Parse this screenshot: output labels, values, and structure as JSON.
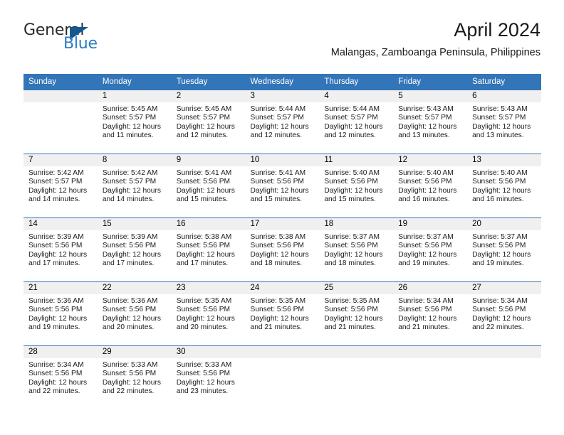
{
  "brand": {
    "name_part1": "General",
    "name_part2": "Blue",
    "triangle_color": "#15588f",
    "blue_color": "#2e7cc4"
  },
  "header": {
    "title": "April 2024",
    "subtitle": "Malangas, Zamboanga Peninsula, Philippines"
  },
  "theme": {
    "header_blue": "#3275b8",
    "daynum_band": "#f0f0f0",
    "text": "#1a1a1a"
  },
  "weekday_headers": [
    "Sunday",
    "Monday",
    "Tuesday",
    "Wednesday",
    "Thursday",
    "Friday",
    "Saturday"
  ],
  "labels": {
    "sunrise_prefix": "Sunrise:",
    "sunset_prefix": "Sunset:",
    "daylight_prefix": "Daylight:"
  },
  "weeks": [
    {
      "days": [
        {
          "num": "",
          "empty": true,
          "sunrise": "",
          "sunset": "",
          "daylight_l1": "",
          "daylight_l2": ""
        },
        {
          "num": "1",
          "empty": false,
          "sunrise": "Sunrise: 5:45 AM",
          "sunset": "Sunset: 5:57 PM",
          "daylight_l1": "Daylight: 12 hours",
          "daylight_l2": "and 11 minutes."
        },
        {
          "num": "2",
          "empty": false,
          "sunrise": "Sunrise: 5:45 AM",
          "sunset": "Sunset: 5:57 PM",
          "daylight_l1": "Daylight: 12 hours",
          "daylight_l2": "and 12 minutes."
        },
        {
          "num": "3",
          "empty": false,
          "sunrise": "Sunrise: 5:44 AM",
          "sunset": "Sunset: 5:57 PM",
          "daylight_l1": "Daylight: 12 hours",
          "daylight_l2": "and 12 minutes."
        },
        {
          "num": "4",
          "empty": false,
          "sunrise": "Sunrise: 5:44 AM",
          "sunset": "Sunset: 5:57 PM",
          "daylight_l1": "Daylight: 12 hours",
          "daylight_l2": "and 12 minutes."
        },
        {
          "num": "5",
          "empty": false,
          "sunrise": "Sunrise: 5:43 AM",
          "sunset": "Sunset: 5:57 PM",
          "daylight_l1": "Daylight: 12 hours",
          "daylight_l2": "and 13 minutes."
        },
        {
          "num": "6",
          "empty": false,
          "sunrise": "Sunrise: 5:43 AM",
          "sunset": "Sunset: 5:57 PM",
          "daylight_l1": "Daylight: 12 hours",
          "daylight_l2": "and 13 minutes."
        }
      ]
    },
    {
      "days": [
        {
          "num": "7",
          "empty": false,
          "sunrise": "Sunrise: 5:42 AM",
          "sunset": "Sunset: 5:57 PM",
          "daylight_l1": "Daylight: 12 hours",
          "daylight_l2": "and 14 minutes."
        },
        {
          "num": "8",
          "empty": false,
          "sunrise": "Sunrise: 5:42 AM",
          "sunset": "Sunset: 5:57 PM",
          "daylight_l1": "Daylight: 12 hours",
          "daylight_l2": "and 14 minutes."
        },
        {
          "num": "9",
          "empty": false,
          "sunrise": "Sunrise: 5:41 AM",
          "sunset": "Sunset: 5:56 PM",
          "daylight_l1": "Daylight: 12 hours",
          "daylight_l2": "and 15 minutes."
        },
        {
          "num": "10",
          "empty": false,
          "sunrise": "Sunrise: 5:41 AM",
          "sunset": "Sunset: 5:56 PM",
          "daylight_l1": "Daylight: 12 hours",
          "daylight_l2": "and 15 minutes."
        },
        {
          "num": "11",
          "empty": false,
          "sunrise": "Sunrise: 5:40 AM",
          "sunset": "Sunset: 5:56 PM",
          "daylight_l1": "Daylight: 12 hours",
          "daylight_l2": "and 15 minutes."
        },
        {
          "num": "12",
          "empty": false,
          "sunrise": "Sunrise: 5:40 AM",
          "sunset": "Sunset: 5:56 PM",
          "daylight_l1": "Daylight: 12 hours",
          "daylight_l2": "and 16 minutes."
        },
        {
          "num": "13",
          "empty": false,
          "sunrise": "Sunrise: 5:40 AM",
          "sunset": "Sunset: 5:56 PM",
          "daylight_l1": "Daylight: 12 hours",
          "daylight_l2": "and 16 minutes."
        }
      ]
    },
    {
      "days": [
        {
          "num": "14",
          "empty": false,
          "sunrise": "Sunrise: 5:39 AM",
          "sunset": "Sunset: 5:56 PM",
          "daylight_l1": "Daylight: 12 hours",
          "daylight_l2": "and 17 minutes."
        },
        {
          "num": "15",
          "empty": false,
          "sunrise": "Sunrise: 5:39 AM",
          "sunset": "Sunset: 5:56 PM",
          "daylight_l1": "Daylight: 12 hours",
          "daylight_l2": "and 17 minutes."
        },
        {
          "num": "16",
          "empty": false,
          "sunrise": "Sunrise: 5:38 AM",
          "sunset": "Sunset: 5:56 PM",
          "daylight_l1": "Daylight: 12 hours",
          "daylight_l2": "and 17 minutes."
        },
        {
          "num": "17",
          "empty": false,
          "sunrise": "Sunrise: 5:38 AM",
          "sunset": "Sunset: 5:56 PM",
          "daylight_l1": "Daylight: 12 hours",
          "daylight_l2": "and 18 minutes."
        },
        {
          "num": "18",
          "empty": false,
          "sunrise": "Sunrise: 5:37 AM",
          "sunset": "Sunset: 5:56 PM",
          "daylight_l1": "Daylight: 12 hours",
          "daylight_l2": "and 18 minutes."
        },
        {
          "num": "19",
          "empty": false,
          "sunrise": "Sunrise: 5:37 AM",
          "sunset": "Sunset: 5:56 PM",
          "daylight_l1": "Daylight: 12 hours",
          "daylight_l2": "and 19 minutes."
        },
        {
          "num": "20",
          "empty": false,
          "sunrise": "Sunrise: 5:37 AM",
          "sunset": "Sunset: 5:56 PM",
          "daylight_l1": "Daylight: 12 hours",
          "daylight_l2": "and 19 minutes."
        }
      ]
    },
    {
      "days": [
        {
          "num": "21",
          "empty": false,
          "sunrise": "Sunrise: 5:36 AM",
          "sunset": "Sunset: 5:56 PM",
          "daylight_l1": "Daylight: 12 hours",
          "daylight_l2": "and 19 minutes."
        },
        {
          "num": "22",
          "empty": false,
          "sunrise": "Sunrise: 5:36 AM",
          "sunset": "Sunset: 5:56 PM",
          "daylight_l1": "Daylight: 12 hours",
          "daylight_l2": "and 20 minutes."
        },
        {
          "num": "23",
          "empty": false,
          "sunrise": "Sunrise: 5:35 AM",
          "sunset": "Sunset: 5:56 PM",
          "daylight_l1": "Daylight: 12 hours",
          "daylight_l2": "and 20 minutes."
        },
        {
          "num": "24",
          "empty": false,
          "sunrise": "Sunrise: 5:35 AM",
          "sunset": "Sunset: 5:56 PM",
          "daylight_l1": "Daylight: 12 hours",
          "daylight_l2": "and 21 minutes."
        },
        {
          "num": "25",
          "empty": false,
          "sunrise": "Sunrise: 5:35 AM",
          "sunset": "Sunset: 5:56 PM",
          "daylight_l1": "Daylight: 12 hours",
          "daylight_l2": "and 21 minutes."
        },
        {
          "num": "26",
          "empty": false,
          "sunrise": "Sunrise: 5:34 AM",
          "sunset": "Sunset: 5:56 PM",
          "daylight_l1": "Daylight: 12 hours",
          "daylight_l2": "and 21 minutes."
        },
        {
          "num": "27",
          "empty": false,
          "sunrise": "Sunrise: 5:34 AM",
          "sunset": "Sunset: 5:56 PM",
          "daylight_l1": "Daylight: 12 hours",
          "daylight_l2": "and 22 minutes."
        }
      ]
    },
    {
      "days": [
        {
          "num": "28",
          "empty": false,
          "sunrise": "Sunrise: 5:34 AM",
          "sunset": "Sunset: 5:56 PM",
          "daylight_l1": "Daylight: 12 hours",
          "daylight_l2": "and 22 minutes."
        },
        {
          "num": "29",
          "empty": false,
          "sunrise": "Sunrise: 5:33 AM",
          "sunset": "Sunset: 5:56 PM",
          "daylight_l1": "Daylight: 12 hours",
          "daylight_l2": "and 22 minutes."
        },
        {
          "num": "30",
          "empty": false,
          "sunrise": "Sunrise: 5:33 AM",
          "sunset": "Sunset: 5:56 PM",
          "daylight_l1": "Daylight: 12 hours",
          "daylight_l2": "and 23 minutes."
        },
        {
          "num": "",
          "empty": true,
          "sunrise": "",
          "sunset": "",
          "daylight_l1": "",
          "daylight_l2": ""
        },
        {
          "num": "",
          "empty": true,
          "sunrise": "",
          "sunset": "",
          "daylight_l1": "",
          "daylight_l2": ""
        },
        {
          "num": "",
          "empty": true,
          "sunrise": "",
          "sunset": "",
          "daylight_l1": "",
          "daylight_l2": ""
        },
        {
          "num": "",
          "empty": true,
          "sunrise": "",
          "sunset": "",
          "daylight_l1": "",
          "daylight_l2": ""
        }
      ]
    }
  ]
}
